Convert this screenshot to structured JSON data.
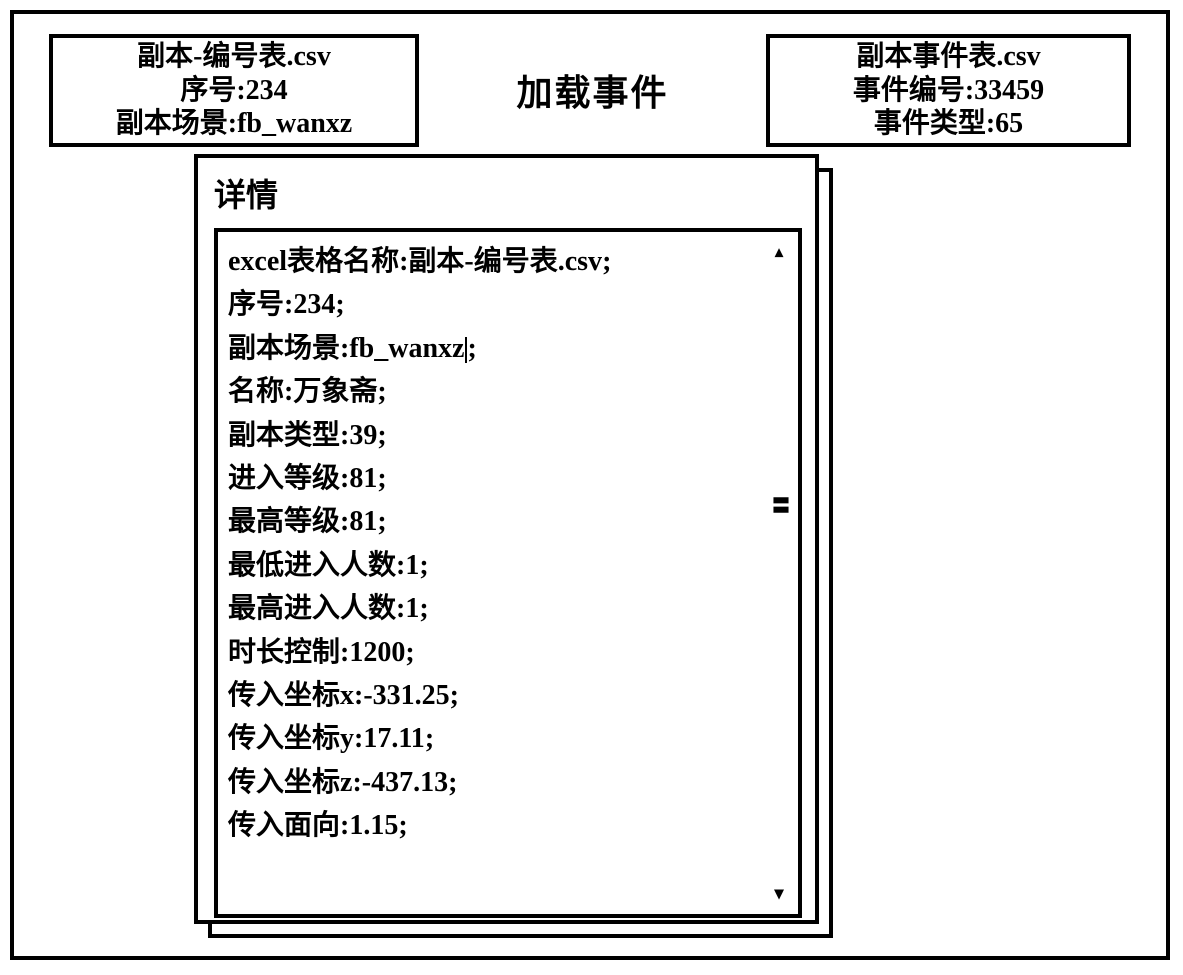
{
  "top": {
    "left_box": {
      "line1": "副本-编号表.csv",
      "line2_label": "序号",
      "line2_value": "234",
      "line3_label": "副本场景",
      "line3_value": "fb_wanxz"
    },
    "center_label": "加载事件",
    "right_box": {
      "line1": "副本事件表.csv",
      "line2_label": "事件编号",
      "line2_value": "33459",
      "line3_label": "事件类型",
      "line3_value": "65"
    }
  },
  "detail": {
    "title": "详情",
    "rows": [
      {
        "label": "excel表格名称",
        "value": "副本-编号表.csv"
      },
      {
        "label": "序号",
        "value": "234"
      },
      {
        "label": "副本场景",
        "value": "fb_wanxz",
        "cursor": true
      },
      {
        "label": "名称",
        "value": "万象斋"
      },
      {
        "label": "副本类型",
        "value": "39"
      },
      {
        "label": "进入等级",
        "value": "81"
      },
      {
        "label": "最高等级",
        "value": "81"
      },
      {
        "label": "最低进入人数",
        "value": "1"
      },
      {
        "label": "最高进入人数",
        "value": "1"
      },
      {
        "label": "时长控制",
        "value": "1200"
      },
      {
        "label": "传入坐标x",
        "value": "-331.25"
      },
      {
        "label": "传入坐标y",
        "value": "17.11"
      },
      {
        "label": "传入坐标z",
        "value": "-437.13"
      },
      {
        "label": "传入面向",
        "value": "1.15"
      }
    ],
    "scroll": {
      "up": "▴",
      "mid": "〓",
      "down": "▾"
    }
  }
}
